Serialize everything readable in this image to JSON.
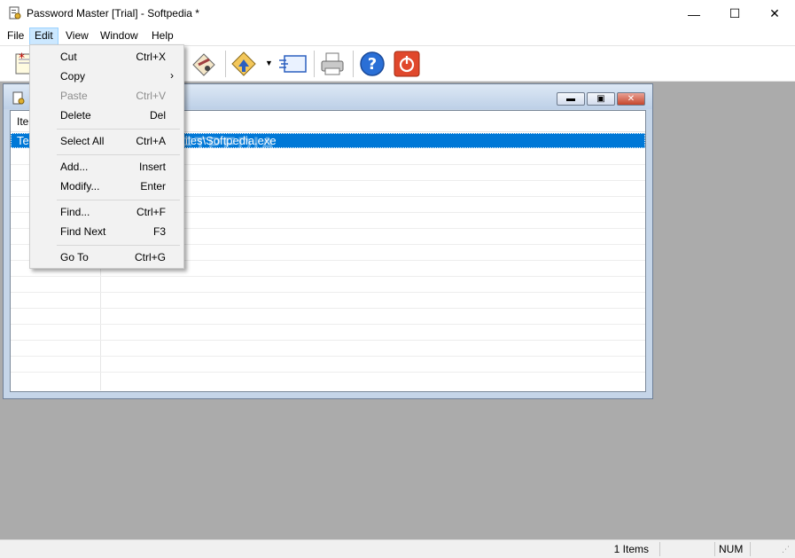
{
  "window": {
    "title": "Password Master [Trial]  - Softpedia *",
    "controls": {
      "minimize": "—",
      "maximize": "☐",
      "close": "✕"
    }
  },
  "menubar": {
    "items": [
      {
        "label": "File"
      },
      {
        "label": "Edit"
      },
      {
        "label": "View"
      },
      {
        "label": "Window"
      },
      {
        "label": "Help"
      }
    ]
  },
  "toolbar": {
    "buttons": [
      "new-icon",
      "edit-icon",
      "import-icon",
      "export-icon",
      "print-icon",
      "help-icon",
      "power-icon"
    ]
  },
  "child_window": {
    "controls": {
      "minimize": "▬",
      "restore": "▣",
      "close": "✕"
    }
  },
  "list": {
    "header": "Ite",
    "selected_row_left": "Te",
    "selected_row_right": "iles\\Softpedia.exe"
  },
  "watermark": "SOFTPEDIA",
  "edit_menu": {
    "items": [
      {
        "label": "Cut",
        "shortcut": "Ctrl+X"
      },
      {
        "label": "Copy",
        "shortcut": "›"
      },
      {
        "label": "Paste",
        "shortcut": "Ctrl+V"
      },
      {
        "label": "Delete",
        "shortcut": "Del"
      },
      {
        "label": "Select All",
        "shortcut": "Ctrl+A"
      },
      {
        "label": "Add...",
        "shortcut": "Insert"
      },
      {
        "label": "Modify...",
        "shortcut": "Enter"
      },
      {
        "label": "Find...",
        "shortcut": "Ctrl+F"
      },
      {
        "label": "Find Next",
        "shortcut": "F3"
      },
      {
        "label": "Go To",
        "shortcut": "Ctrl+G"
      }
    ]
  },
  "statusbar": {
    "count": "1 Items",
    "num": "NUM"
  },
  "colors": {
    "selection": "#0078d7",
    "mdi_background": "#ababab",
    "menu_highlight": "#cce8ff"
  }
}
